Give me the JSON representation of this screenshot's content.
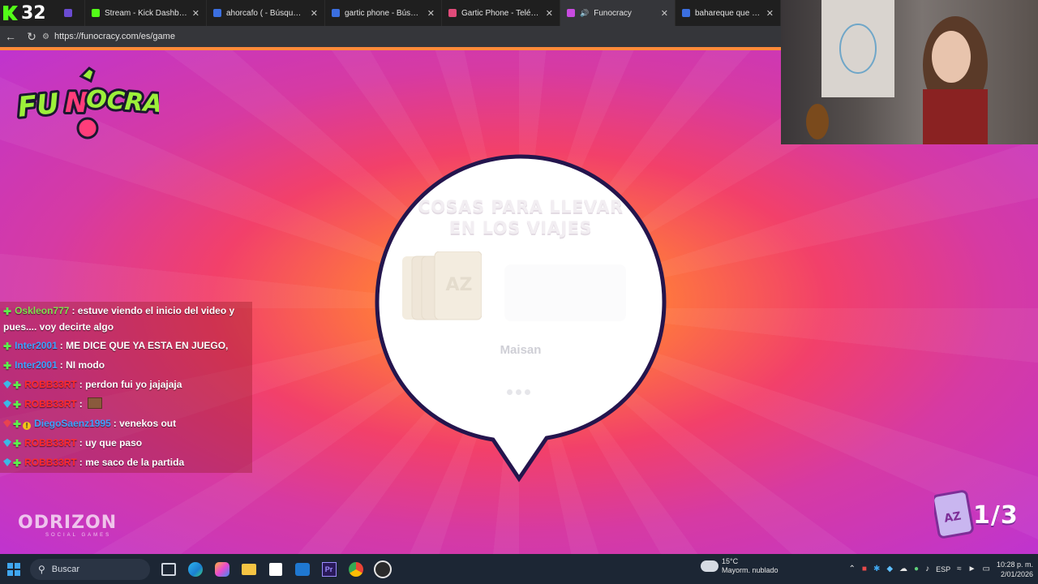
{
  "browser": {
    "kick_count": "32",
    "tabs": [
      {
        "title": "",
        "color": "#6a4bd1",
        "active": false
      },
      {
        "title": "Stream - Kick Dashboard",
        "color": "#53fc18",
        "active": false
      },
      {
        "title": "ahorcafo ( - Búsqueda",
        "color": "#3b6fe0",
        "active": false
      },
      {
        "title": "gartic phone - Búsqueda",
        "color": "#3b6fe0",
        "active": false
      },
      {
        "title": "Gartic Phone - Teléfono D",
        "color": "#e04b7a",
        "active": false
      },
      {
        "title": "Funocracy",
        "color": "#c84be0",
        "active": true
      },
      {
        "title": "bahareque que es - Búsq",
        "color": "#3b6fe0",
        "active": false
      }
    ],
    "url": "https://funocracy.com/es/game"
  },
  "game": {
    "prompt_line1": "COSAS PARA LLEVAR",
    "prompt_line2": "EN LOS VIAJES",
    "player_name": "Maisan",
    "counter": "1/3",
    "watermark_brand": "ODRIZON",
    "watermark_sub": "SOCIAL GAMES"
  },
  "chat": [
    {
      "user": "Oskleon777",
      "user_color": "#7fe04f",
      "badges": [
        "plus"
      ],
      "text": ": estuve viendo el inicio del video y pues.... voy decirte algo"
    },
    {
      "user": "Inter2001",
      "user_color": "#3da2ff",
      "badges": [
        "plus"
      ],
      "text": ": ME DICE QUE YA ESTA EN JUEGO,"
    },
    {
      "user": "Inter2001",
      "user_color": "#3da2ff",
      "badges": [
        "plus"
      ],
      "text": ": NI modo"
    },
    {
      "user": "ROBB33RT",
      "user_color": "#ff2a2a",
      "badges": [
        "gem",
        "plus"
      ],
      "text": ": perdon fui yo jajajaja"
    },
    {
      "user": "ROBB33RT",
      "user_color": "#ff2a2a",
      "badges": [
        "gem",
        "plus"
      ],
      "text": ":",
      "emote": true
    },
    {
      "user": "DiegoSaenz1995",
      "user_color": "#3da2ff",
      "badges": [
        "gem-red",
        "plus",
        "coin"
      ],
      "text": ": venekos out"
    },
    {
      "user": "ROBB33RT",
      "user_color": "#ff2a2a",
      "badges": [
        "gem",
        "plus"
      ],
      "text": ": uy que paso"
    },
    {
      "user": "ROBB33RT",
      "user_color": "#ff2a2a",
      "badges": [
        "gem",
        "plus"
      ],
      "text": ": me saco de la partida"
    }
  ],
  "taskbar": {
    "search_label": "Buscar",
    "weather_temp": "15°C",
    "weather_desc": "Mayorm. nublado",
    "language": "ESP",
    "time": "10:28 p. m.",
    "date": "2/01/2026"
  }
}
